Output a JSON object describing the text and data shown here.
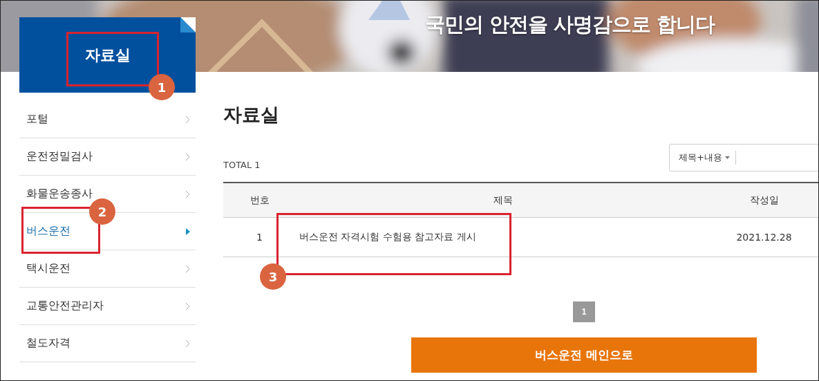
{
  "banner": {
    "slogan": "국민의 안전을 사명감으로 합니다"
  },
  "sidebar": {
    "title": "자료실",
    "items": [
      {
        "label": "포털",
        "selected": false
      },
      {
        "label": "운전정밀검사",
        "selected": false
      },
      {
        "label": "화물운송종사",
        "selected": false
      },
      {
        "label": "버스운전",
        "selected": true
      },
      {
        "label": "택시운전",
        "selected": false
      },
      {
        "label": "교통안전관리자",
        "selected": false
      },
      {
        "label": "철도자격",
        "selected": false
      }
    ]
  },
  "main": {
    "title": "자료실",
    "total": "TOTAL 1",
    "search": {
      "scope": "제목+내용"
    },
    "table": {
      "columns": [
        "번호",
        "제목",
        "작성일"
      ],
      "rows": [
        {
          "cells": [
            "1",
            "버스운전 자격시험 수험용 참고자료 게시",
            "2021.12.28"
          ]
        }
      ]
    },
    "pagination": [
      {
        "label": "1",
        "selected": true
      }
    ],
    "main_button": "버스운전 메인으로"
  },
  "annotations": [
    {
      "label": "1"
    },
    {
      "label": "2"
    },
    {
      "label": "3"
    }
  ]
}
